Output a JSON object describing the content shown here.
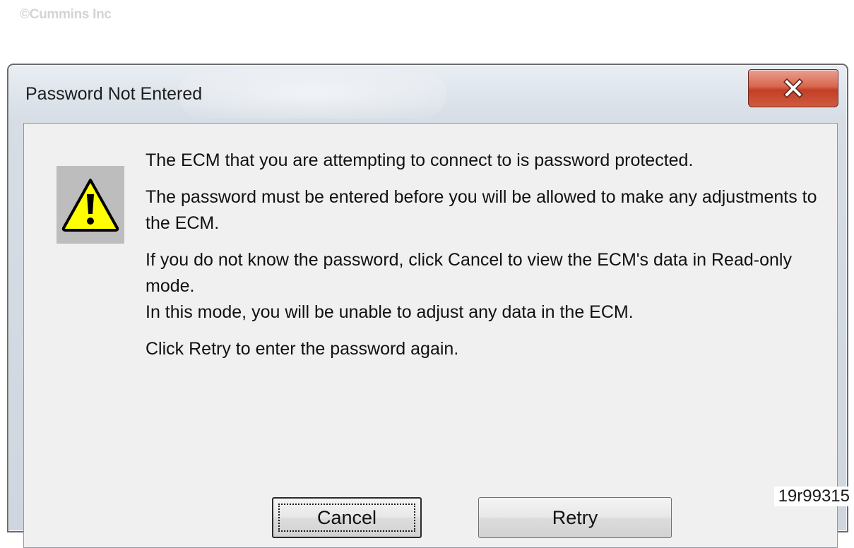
{
  "watermark": "©Cummins Inc",
  "figure_id": "19r99315",
  "dialog": {
    "title": "Password Not Entered",
    "close_icon": "close-x-icon",
    "alert_icon": "warning-icon",
    "messages": [
      "The ECM that you are attempting to connect to is password protected.",
      "The password must be entered before you will be allowed to make any adjustments to the ECM.",
      "If you do not know the password, click Cancel to view the ECM's data in Read-only mode.",
      "In this mode, you will be unable to adjust any data in the ECM.",
      "Click Retry to enter the password again."
    ],
    "buttons": {
      "cancel": "Cancel",
      "retry": "Retry"
    }
  },
  "colors": {
    "close_button": "#c9462c",
    "warning_fill": "#ffff00",
    "client_background": "#f0f0f0"
  }
}
